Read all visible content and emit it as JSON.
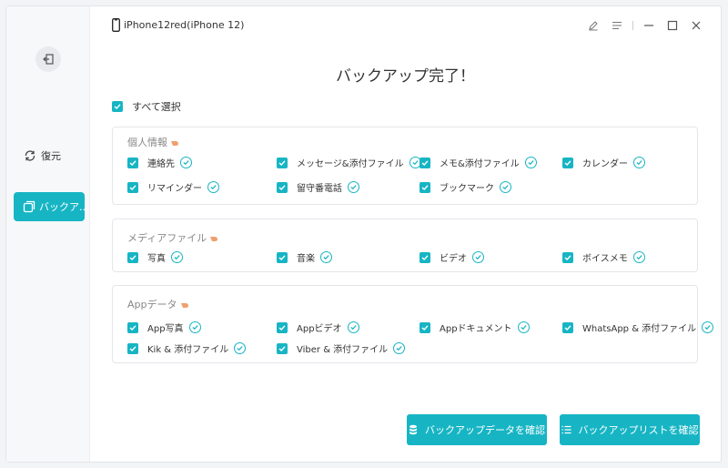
{
  "app": {
    "device_name": "iPhone12red(iPhone 12)"
  },
  "sidebar": {
    "items": [
      {
        "label": "復元",
        "icon": "restore-icon"
      },
      {
        "label": "バックア...",
        "icon": "backup-icon",
        "active": true
      }
    ]
  },
  "main": {
    "title": "バックアップ完了！",
    "select_all_label": "すべて選択"
  },
  "groups": [
    {
      "title": "個人情報",
      "items": [
        "連絡先",
        "メッセージ&添付ファイル",
        "メモ&添付ファイル",
        "カレンダー",
        "リマインダー",
        "留守番電話",
        "ブックマーク"
      ]
    },
    {
      "title": "メディアファイル",
      "items": [
        "写真",
        "音楽",
        "ビデオ",
        "ボイスメモ"
      ]
    },
    {
      "title": "Appデータ",
      "items": [
        "App写真",
        "Appビデオ",
        "Appドキュメント",
        "WhatsApp & 添付ファイル",
        "Kik & 添付ファイル",
        "Viber & 添付ファイル"
      ]
    }
  ],
  "buttons": {
    "view_backup_data": "バックアップデータを確認",
    "view_backup_list": "バックアップリストを確認"
  },
  "colors": {
    "accent": "#17b5c4",
    "hand_icon": "#f0a070"
  }
}
